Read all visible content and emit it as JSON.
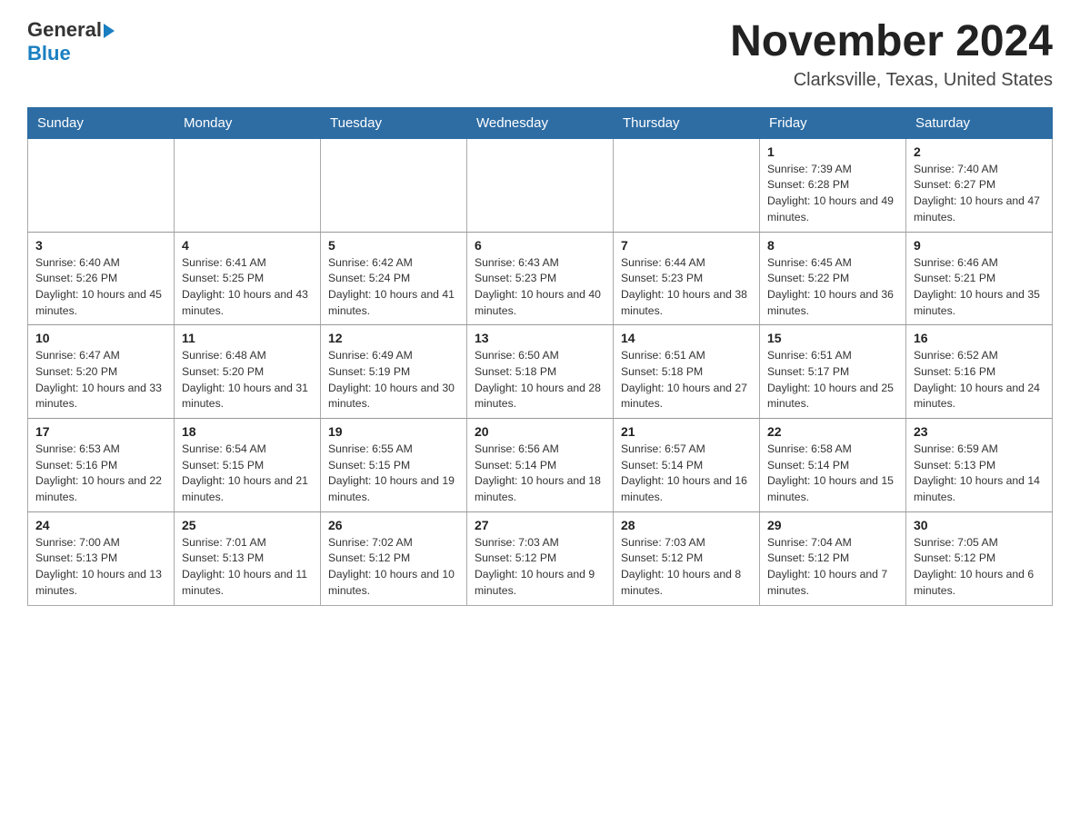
{
  "header": {
    "logo_general": "General",
    "logo_blue": "Blue",
    "month_title": "November 2024",
    "location": "Clarksville, Texas, United States"
  },
  "weekdays": [
    "Sunday",
    "Monday",
    "Tuesday",
    "Wednesday",
    "Thursday",
    "Friday",
    "Saturday"
  ],
  "weeks": [
    [
      {
        "day": "",
        "info": ""
      },
      {
        "day": "",
        "info": ""
      },
      {
        "day": "",
        "info": ""
      },
      {
        "day": "",
        "info": ""
      },
      {
        "day": "",
        "info": ""
      },
      {
        "day": "1",
        "info": "Sunrise: 7:39 AM\nSunset: 6:28 PM\nDaylight: 10 hours and 49 minutes."
      },
      {
        "day": "2",
        "info": "Sunrise: 7:40 AM\nSunset: 6:27 PM\nDaylight: 10 hours and 47 minutes."
      }
    ],
    [
      {
        "day": "3",
        "info": "Sunrise: 6:40 AM\nSunset: 5:26 PM\nDaylight: 10 hours and 45 minutes."
      },
      {
        "day": "4",
        "info": "Sunrise: 6:41 AM\nSunset: 5:25 PM\nDaylight: 10 hours and 43 minutes."
      },
      {
        "day": "5",
        "info": "Sunrise: 6:42 AM\nSunset: 5:24 PM\nDaylight: 10 hours and 41 minutes."
      },
      {
        "day": "6",
        "info": "Sunrise: 6:43 AM\nSunset: 5:23 PM\nDaylight: 10 hours and 40 minutes."
      },
      {
        "day": "7",
        "info": "Sunrise: 6:44 AM\nSunset: 5:23 PM\nDaylight: 10 hours and 38 minutes."
      },
      {
        "day": "8",
        "info": "Sunrise: 6:45 AM\nSunset: 5:22 PM\nDaylight: 10 hours and 36 minutes."
      },
      {
        "day": "9",
        "info": "Sunrise: 6:46 AM\nSunset: 5:21 PM\nDaylight: 10 hours and 35 minutes."
      }
    ],
    [
      {
        "day": "10",
        "info": "Sunrise: 6:47 AM\nSunset: 5:20 PM\nDaylight: 10 hours and 33 minutes."
      },
      {
        "day": "11",
        "info": "Sunrise: 6:48 AM\nSunset: 5:20 PM\nDaylight: 10 hours and 31 minutes."
      },
      {
        "day": "12",
        "info": "Sunrise: 6:49 AM\nSunset: 5:19 PM\nDaylight: 10 hours and 30 minutes."
      },
      {
        "day": "13",
        "info": "Sunrise: 6:50 AM\nSunset: 5:18 PM\nDaylight: 10 hours and 28 minutes."
      },
      {
        "day": "14",
        "info": "Sunrise: 6:51 AM\nSunset: 5:18 PM\nDaylight: 10 hours and 27 minutes."
      },
      {
        "day": "15",
        "info": "Sunrise: 6:51 AM\nSunset: 5:17 PM\nDaylight: 10 hours and 25 minutes."
      },
      {
        "day": "16",
        "info": "Sunrise: 6:52 AM\nSunset: 5:16 PM\nDaylight: 10 hours and 24 minutes."
      }
    ],
    [
      {
        "day": "17",
        "info": "Sunrise: 6:53 AM\nSunset: 5:16 PM\nDaylight: 10 hours and 22 minutes."
      },
      {
        "day": "18",
        "info": "Sunrise: 6:54 AM\nSunset: 5:15 PM\nDaylight: 10 hours and 21 minutes."
      },
      {
        "day": "19",
        "info": "Sunrise: 6:55 AM\nSunset: 5:15 PM\nDaylight: 10 hours and 19 minutes."
      },
      {
        "day": "20",
        "info": "Sunrise: 6:56 AM\nSunset: 5:14 PM\nDaylight: 10 hours and 18 minutes."
      },
      {
        "day": "21",
        "info": "Sunrise: 6:57 AM\nSunset: 5:14 PM\nDaylight: 10 hours and 16 minutes."
      },
      {
        "day": "22",
        "info": "Sunrise: 6:58 AM\nSunset: 5:14 PM\nDaylight: 10 hours and 15 minutes."
      },
      {
        "day": "23",
        "info": "Sunrise: 6:59 AM\nSunset: 5:13 PM\nDaylight: 10 hours and 14 minutes."
      }
    ],
    [
      {
        "day": "24",
        "info": "Sunrise: 7:00 AM\nSunset: 5:13 PM\nDaylight: 10 hours and 13 minutes."
      },
      {
        "day": "25",
        "info": "Sunrise: 7:01 AM\nSunset: 5:13 PM\nDaylight: 10 hours and 11 minutes."
      },
      {
        "day": "26",
        "info": "Sunrise: 7:02 AM\nSunset: 5:12 PM\nDaylight: 10 hours and 10 minutes."
      },
      {
        "day": "27",
        "info": "Sunrise: 7:03 AM\nSunset: 5:12 PM\nDaylight: 10 hours and 9 minutes."
      },
      {
        "day": "28",
        "info": "Sunrise: 7:03 AM\nSunset: 5:12 PM\nDaylight: 10 hours and 8 minutes."
      },
      {
        "day": "29",
        "info": "Sunrise: 7:04 AM\nSunset: 5:12 PM\nDaylight: 10 hours and 7 minutes."
      },
      {
        "day": "30",
        "info": "Sunrise: 7:05 AM\nSunset: 5:12 PM\nDaylight: 10 hours and 6 minutes."
      }
    ]
  ]
}
